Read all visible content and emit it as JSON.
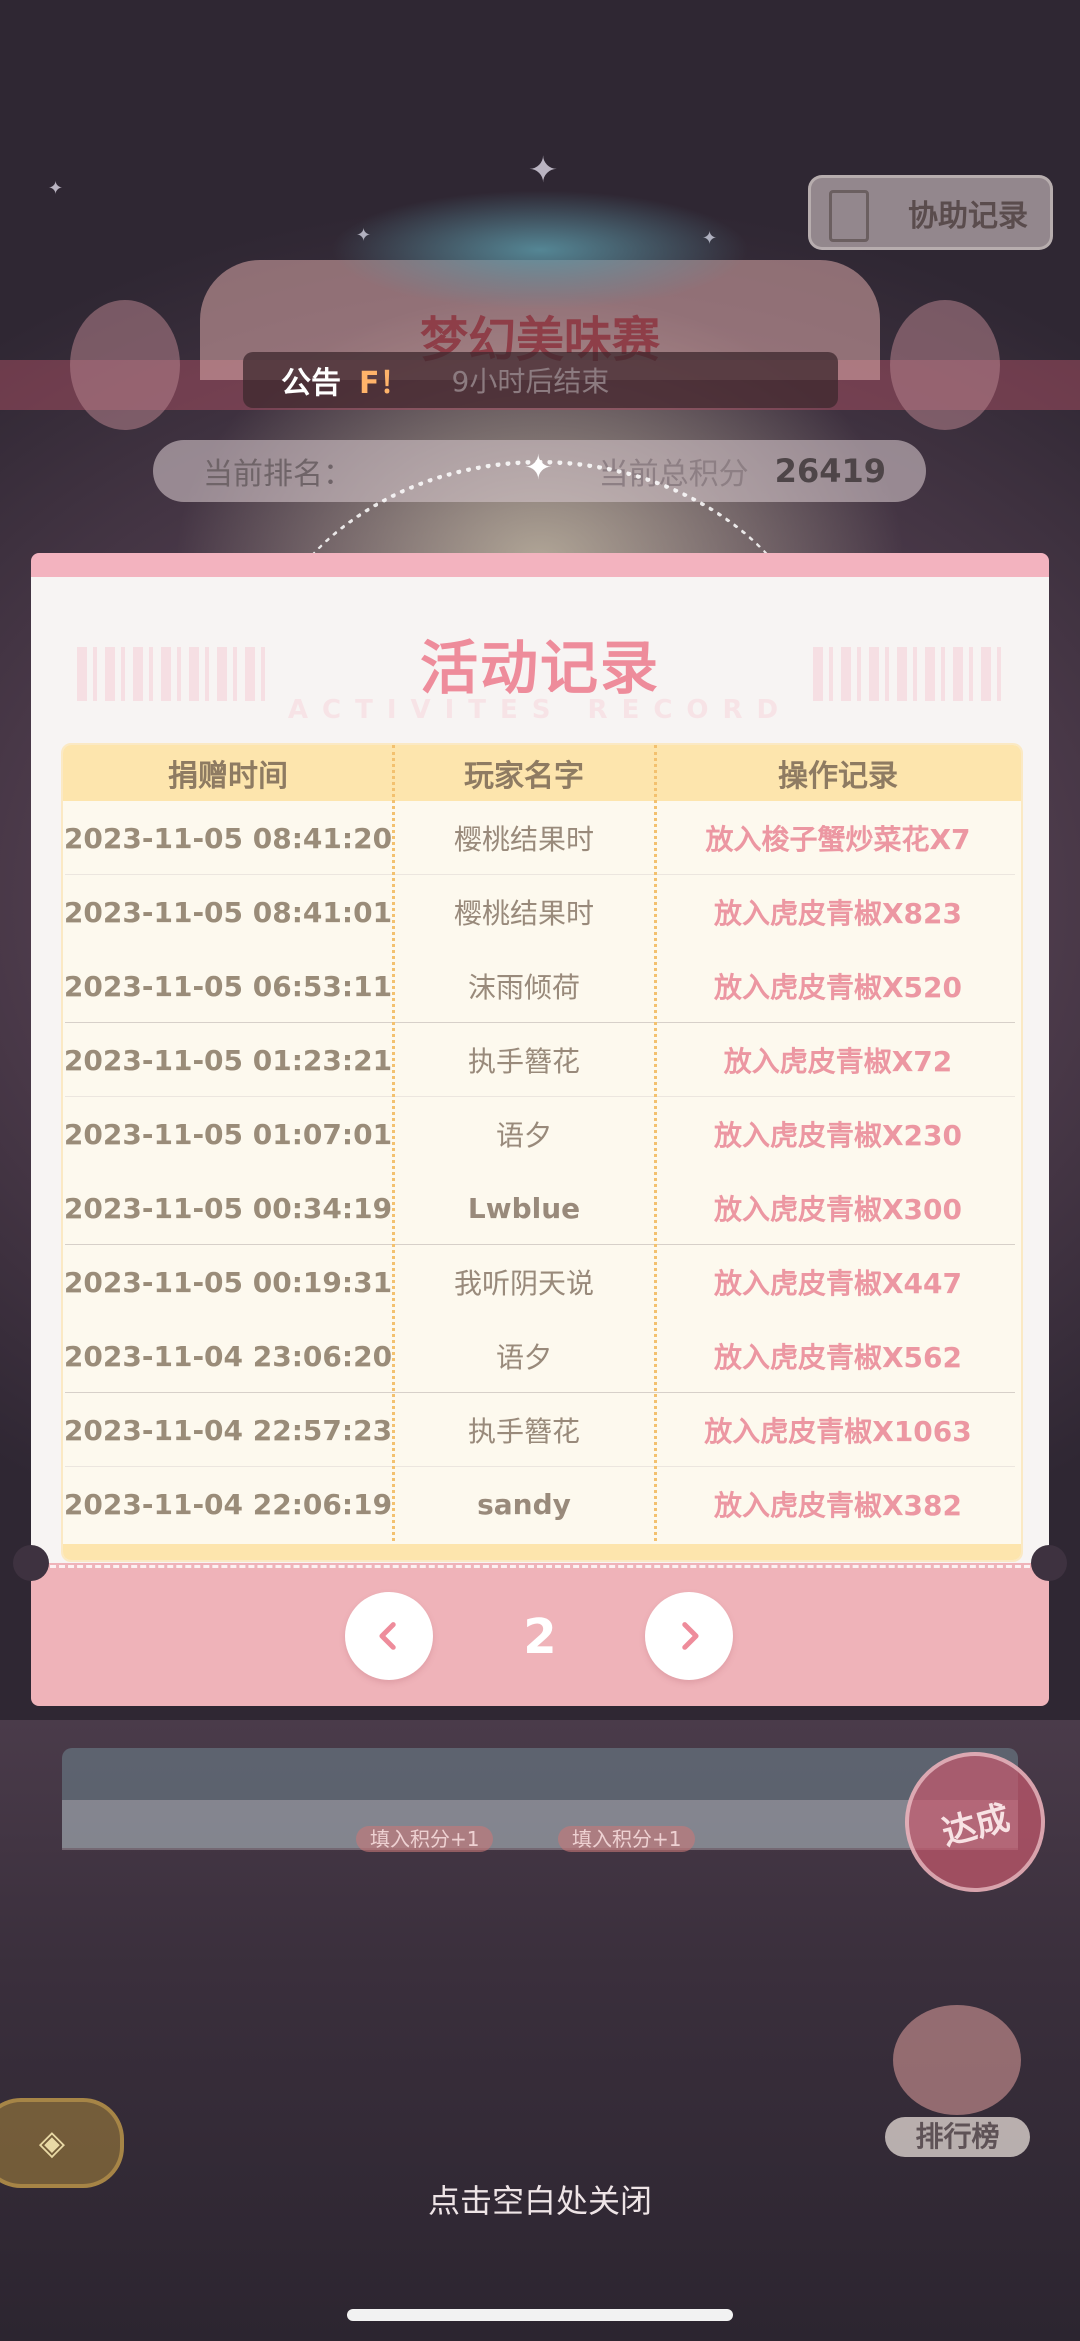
{
  "top": {
    "assist_label": "协助记录",
    "event_title": "梦幻美味赛",
    "announce_label": "公告",
    "announce_mark": "F！",
    "announce_text": "9小时后结束",
    "rank_label": "当前排名：",
    "score_label": "当前总积分",
    "score_value": "26419"
  },
  "modal": {
    "title": "活动记录",
    "subtitle": "ACTIVITES RECORD",
    "columns": [
      "捐赠时间",
      "玩家名字",
      "操作记录"
    ],
    "rows": [
      {
        "time": "2023-11-05 08:41:20",
        "name": "樱桃结果时",
        "op": "放入梭子蟹炒菜花X7"
      },
      {
        "time": "2023-11-05 08:41:01",
        "name": "樱桃结果时",
        "op": "放入虎皮青椒X823"
      },
      {
        "time": "2023-11-05 06:53:11",
        "name": "沫雨倾荷",
        "op": "放入虎皮青椒X520"
      },
      {
        "time": "2023-11-05 01:23:21",
        "name": "执手簪花",
        "op": "放入虎皮青椒X72"
      },
      {
        "time": "2023-11-05 01:07:01",
        "name": "语夕",
        "op": "放入虎皮青椒X230"
      },
      {
        "time": "2023-11-05 00:34:19",
        "name": "Lwblue",
        "op": "放入虎皮青椒X300"
      },
      {
        "time": "2023-11-05 00:19:31",
        "name": "我听阴天说",
        "op": "放入虎皮青椒X447"
      },
      {
        "time": "2023-11-04 23:06:20",
        "name": "语夕",
        "op": "放入虎皮青椒X562"
      },
      {
        "time": "2023-11-04 22:57:23",
        "name": "执手簪花",
        "op": "放入虎皮青椒X1063"
      },
      {
        "time": "2023-11-04 22:06:19",
        "name": "sandy",
        "op": "放入虎皮青椒X382"
      }
    ],
    "page": "2"
  },
  "lower": {
    "pill_1": "填入积分+1",
    "pill_2": "填入积分+1",
    "achieve_label": "达成",
    "rank_label": "排行榜"
  },
  "close_hint": "点击空白处关闭",
  "colors": {
    "accent_pink": "#ee8c9b",
    "header_yellow": "#fde5ad",
    "footer_pink": "#efb3b9"
  },
  "icons": [
    "notebook-icon",
    "chevron-left-icon",
    "chevron-right-icon",
    "back-arrow-icon",
    "sparkle-icon"
  ]
}
